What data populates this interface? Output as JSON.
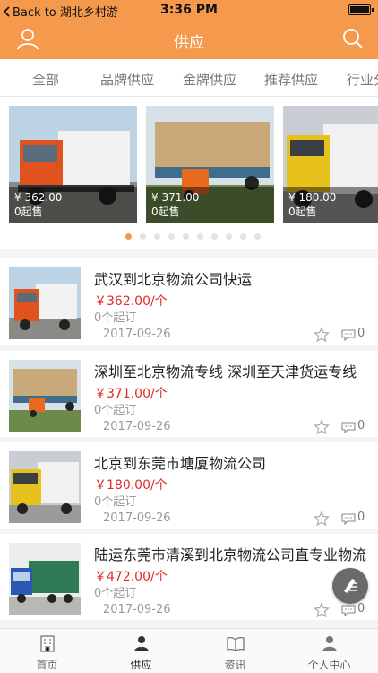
{
  "status_bar": {
    "back_label": "Back to 湖北乡村游",
    "time": "3:36 PM"
  },
  "nav": {
    "title": "供应",
    "left_icon": "user-icon",
    "right_icon": "search-icon"
  },
  "tabs": [
    "全部",
    "品牌供应",
    "金牌供应",
    "推荐供应",
    "行业分"
  ],
  "banner": {
    "slides": [
      {
        "price": "¥ 362.00",
        "moq": "0起售"
      },
      {
        "price": "¥ 371.00",
        "moq": "0起售"
      },
      {
        "price": "¥ 180.00",
        "moq": "0起售"
      }
    ],
    "dot_count": 10,
    "active_dot": 0
  },
  "items": [
    {
      "title": "武汉到北京物流公司快运",
      "price": "￥362.00/个",
      "moq": "0个起订",
      "date": "2017-09-26",
      "comments": "0"
    },
    {
      "title": "深圳至北京物流专线 深圳至天津货运专线",
      "price": "￥371.00/个",
      "moq": "0个起订",
      "date": "2017-09-26",
      "comments": "0"
    },
    {
      "title": "北京到东莞市塘厦物流公司",
      "price": "￥180.00/个",
      "moq": "0个起订",
      "date": "2017-09-26",
      "comments": "0"
    },
    {
      "title": "陆运东莞市清溪到北京物流公司直专业物流",
      "price": "￥472.00/个",
      "moq": "0个起订",
      "date": "2017-09-26",
      "comments": "0"
    }
  ],
  "tabbar": [
    {
      "label": "首页",
      "icon": "building-icon"
    },
    {
      "label": "供应",
      "icon": "supplier-icon"
    },
    {
      "label": "资讯",
      "icon": "book-icon"
    },
    {
      "label": "个人中心",
      "icon": "profile-icon"
    }
  ],
  "colors": {
    "accent": "#f59a4c",
    "price": "#e02a2a"
  }
}
